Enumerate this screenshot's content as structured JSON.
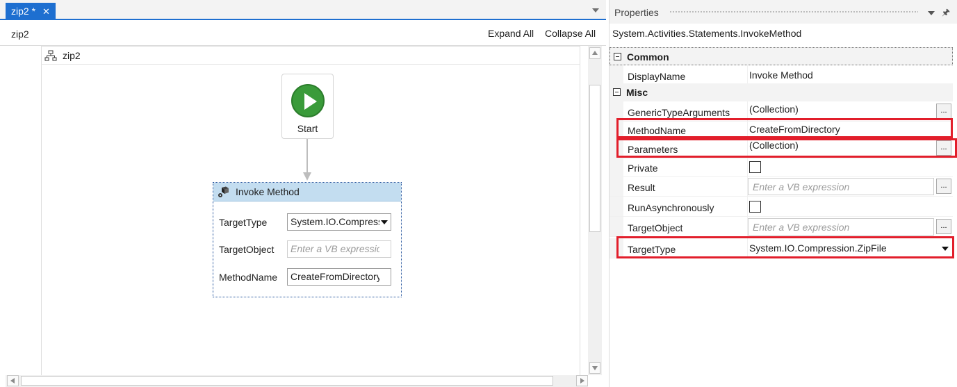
{
  "designer": {
    "tab_label": "zip2 *",
    "tab_close": "✕",
    "breadcrumb": "zip2",
    "expand_all": "Expand All",
    "collapse_all": "Collapse All",
    "flowchart_title": "zip2",
    "start_label": "Start",
    "invoke_method": {
      "title": "Invoke Method",
      "fields": [
        {
          "label": "TargetType",
          "value": "System.IO.Compression.ZipFile"
        },
        {
          "label": "TargetObject",
          "placeholder": "Enter a VB expression"
        },
        {
          "label": "MethodName",
          "value": "CreateFromDirectory"
        }
      ]
    }
  },
  "properties": {
    "title": "Properties",
    "pin": "🖈",
    "type_name": "System.Activities.Statements.InvokeMethod",
    "categories": [
      {
        "name": "Common",
        "properties": [
          {
            "name": "DisplayName",
            "value": "Invoke Method"
          }
        ]
      },
      {
        "name": "Misc",
        "properties": [
          {
            "name": "GenericTypeArguments",
            "value": "(Collection)",
            "button": "..."
          },
          {
            "name": "MethodName",
            "value": "CreateFromDirectory"
          },
          {
            "name": "Parameters",
            "value": "(Collection)",
            "button": "..."
          },
          {
            "name": "Private"
          },
          {
            "name": "Result",
            "placeholder": "Enter a VB expression",
            "button": "..."
          },
          {
            "name": "RunAsynchronously"
          },
          {
            "name": "TargetObject",
            "placeholder": "Enter a VB expression",
            "button": "..."
          },
          {
            "name": "TargetType",
            "value": "System.IO.Compression.ZipFile"
          }
        ]
      }
    ]
  },
  "colors": {
    "tab_accent": "#1e6fd0",
    "start_green": "#3a9b3a",
    "highlight_red": "#e21e2b",
    "activity_header": "#c3ddf0"
  }
}
